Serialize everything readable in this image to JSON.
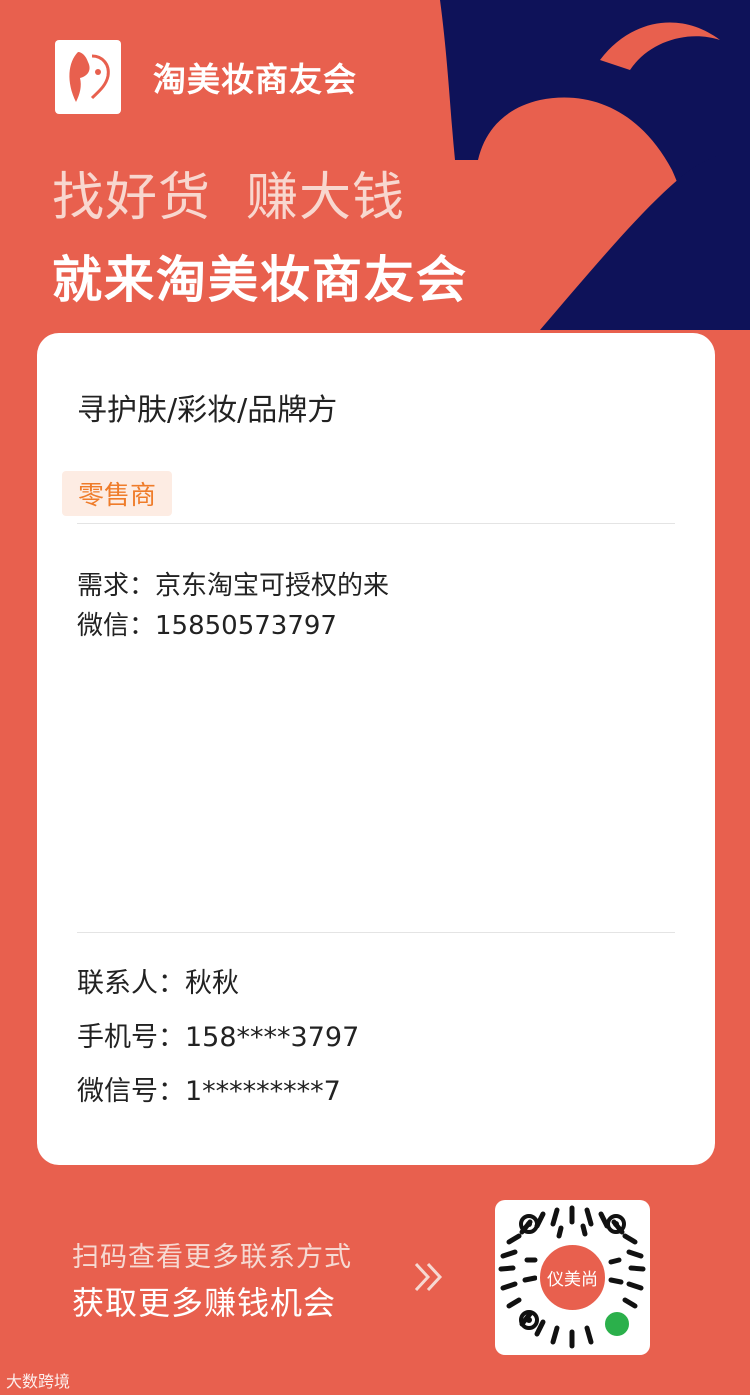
{
  "brand": {
    "name": "淘美妆商友会",
    "accent_color": "#E8604E",
    "dark_color": "#0E1259"
  },
  "headline": {
    "line1": "找好货  赚大钱",
    "line2": "就来淘美妆商友会"
  },
  "card": {
    "title": "寻护肤/彩妆/品牌方",
    "role_badge": "零售商",
    "demand": "需求：京东淘宝可授权的来",
    "wechat": "微信：15850573797",
    "contact_person": "联系人：秋秋",
    "phone": "手机号：158****3797",
    "wechat_id": "微信号：1*********7"
  },
  "footer": {
    "line1": "扫码查看更多联系方式",
    "line2": "获取更多赚钱机会",
    "qr_center_label": "仪美尚"
  },
  "watermark": "大数跨境"
}
